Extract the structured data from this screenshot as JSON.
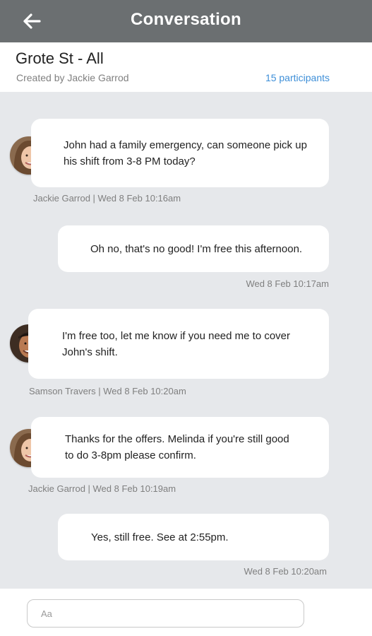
{
  "header": {
    "title": "Conversation",
    "back_icon": "arrow-left-icon"
  },
  "conversation": {
    "title": "Grote St - All",
    "created_by": "Created by Jackie Garrod",
    "participants": "15 participants"
  },
  "messages": [
    {
      "text": "John had a family emergency, can someone pick up his shift from 3-8 PM today?",
      "meta": "Jackie Garrod | Wed 8 Feb 10:16am",
      "sender": "Jackie Garrod",
      "outgoing": false
    },
    {
      "text": "Oh no, that's no good! I'm free this afternoon.",
      "meta": "Wed 8 Feb 10:17am",
      "outgoing": true
    },
    {
      "text": "I'm free too, let me know if you need me to cover John's shift.",
      "meta": "Samson Travers | Wed 8 Feb 10:20am",
      "sender": "Samson Travers",
      "outgoing": false
    },
    {
      "text": "Thanks for the offers. Melinda if you're still good to do 3-8pm please confirm.",
      "meta": "Jackie Garrod | Wed 8 Feb 10:19am",
      "sender": "Jackie Garrod",
      "outgoing": false
    },
    {
      "text": "Yes, still free. See at 2:55pm.",
      "meta": "Wed 8 Feb 10:20am",
      "outgoing": true
    }
  ],
  "composer": {
    "placeholder": "Aa"
  },
  "colors": {
    "header_bg": "#6b6f71",
    "link": "#3e8fd8",
    "chat_bg": "#e6e8eb",
    "bubble_bg": "#ffffff"
  }
}
